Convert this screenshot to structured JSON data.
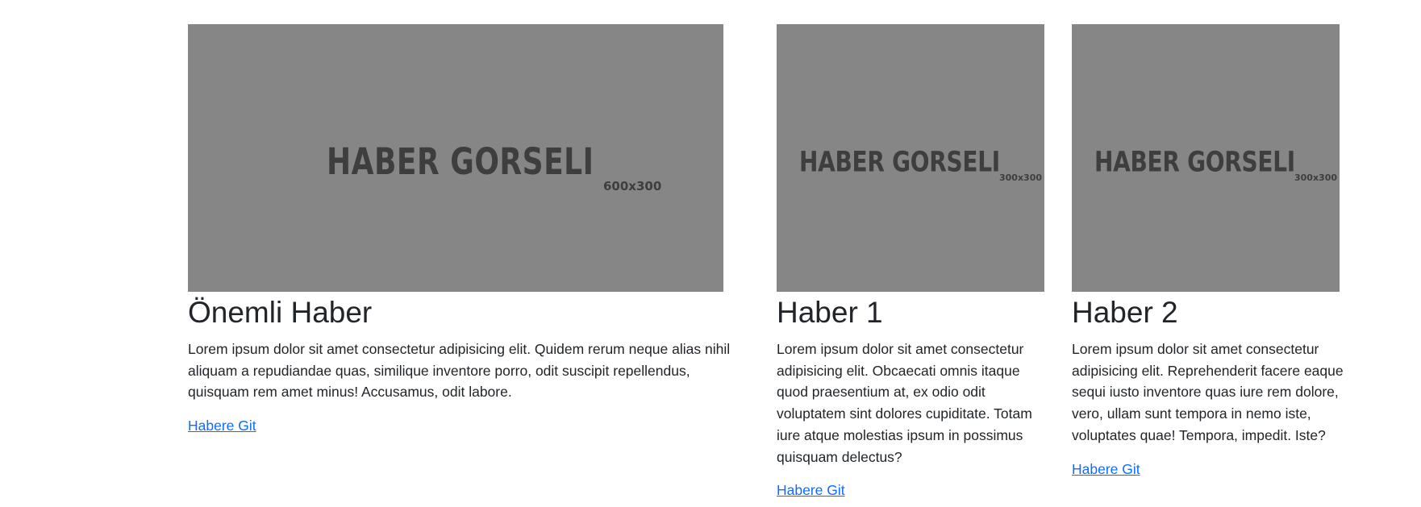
{
  "featured": {
    "image": {
      "title_text": "HABER GORSELI",
      "size_text": "600x300"
    },
    "title": "Önemli Haber",
    "text": "Lorem ipsum dolor sit amet consectetur adipisicing elit. Quidem rerum neque alias nihil aliquam a repudiandae quas, similique inventore porro, odit suscipit repellendus, quisquam rem amet minus! Accusamus, odit labore.",
    "link": "Habere Git"
  },
  "news": [
    {
      "image": {
        "title_text": "HABER GORSELI",
        "size_text": "300x300"
      },
      "title": "Haber 1",
      "text": "Lorem ipsum dolor sit amet consectetur adipisicing elit. Obcaecati omnis itaque quod praesentium at, ex odio odit voluptatem sint dolores cupiditate. Totam iure atque molestias ipsum in possimus quisquam delectus?",
      "link": "Habere Git"
    },
    {
      "image": {
        "title_text": "HABER GORSELI",
        "size_text": "300x300"
      },
      "title": "Haber 2",
      "text": "Lorem ipsum dolor sit amet consectetur adipisicing elit. Reprehenderit facere eaque sequi iusto inventore quas iure rem dolore, vero, ullam sunt tempora in nemo iste, voluptates quae! Tempora, impedit. Iste?",
      "link": "Habere Git"
    }
  ],
  "colors": {
    "image_placeholder": "#868686",
    "image_text": "#3e3e3e",
    "heading": "#212529",
    "link": "#0d6efd"
  }
}
